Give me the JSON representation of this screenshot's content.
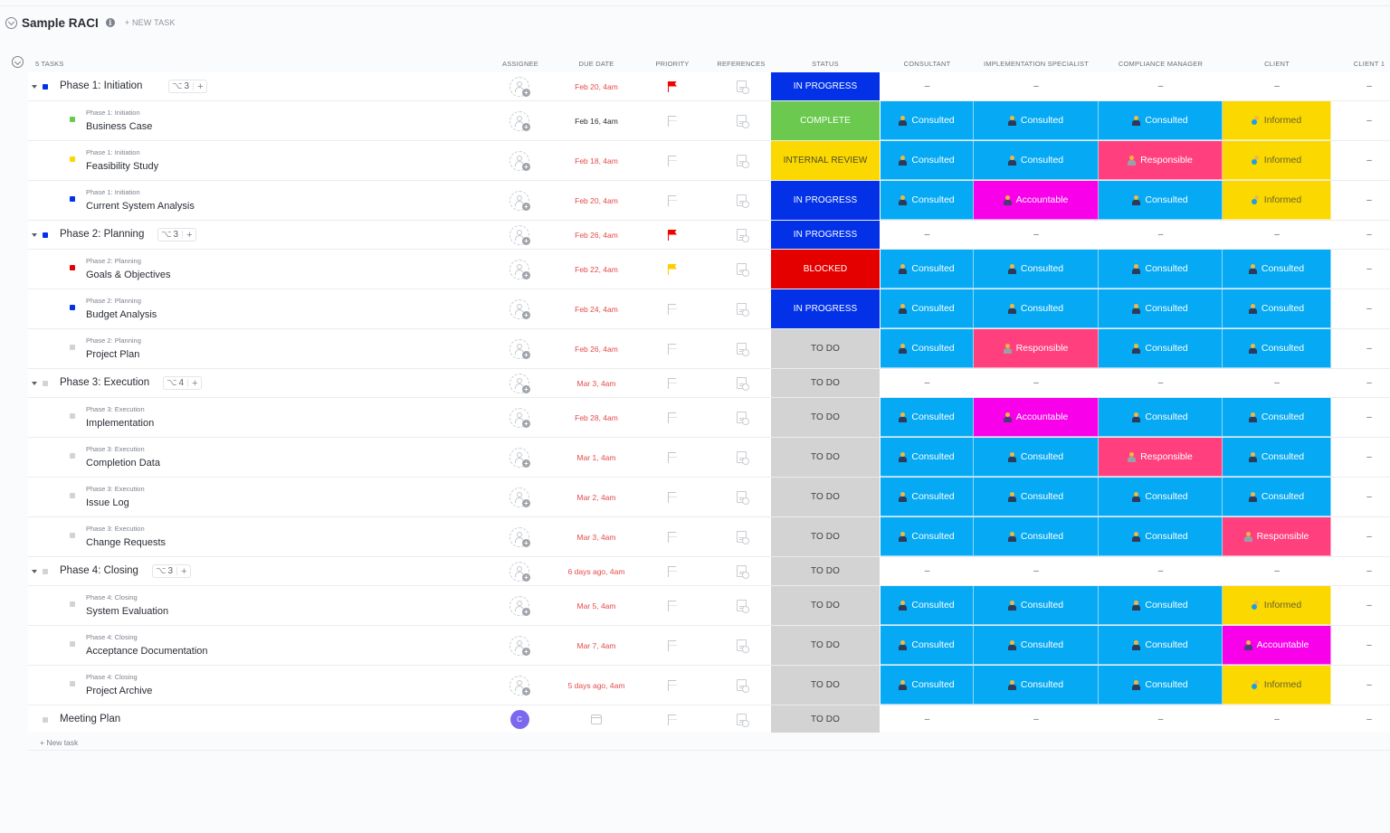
{
  "header": {
    "title": "Sample RACI",
    "new_task_label": "+ NEW TASK",
    "tasks_count": "5 TASKS"
  },
  "columns": {
    "assignee": "ASSIGNEE",
    "due_date": "DUE DATE",
    "priority": "PRIORITY",
    "references": "REFERENCES",
    "status": "STATUS",
    "consultant": "CONSULTANT",
    "implementation_specialist": "IMPLEMENTATION SPECIALIST",
    "compliance_manager": "COMPLIANCE MANAGER",
    "client": "CLIENT",
    "client1": "CLIENT 1"
  },
  "colors": {
    "status": {
      "IN PROGRESS": {
        "bg": "#0231e8",
        "fg": "#ffffff"
      },
      "COMPLETE": {
        "bg": "#6bc950",
        "fg": "#ffffff"
      },
      "INTERNAL REVIEW": {
        "bg": "#fad800",
        "fg": "#4d4a2b"
      },
      "BLOCKED": {
        "bg": "#e50000",
        "fg": "#ffffff"
      },
      "TO DO": {
        "bg": "#d3d3d3",
        "fg": "#3e4147"
      }
    },
    "raci": {
      "Consulted": {
        "bg": "#05a9f4",
        "fg": "#ffffff"
      },
      "Informed": {
        "bg": "#fad800",
        "fg": "#6b6330"
      },
      "Responsible": {
        "bg": "#ff3f7e",
        "fg": "#ffffff"
      },
      "Accountable": {
        "bg": "#f900ea",
        "fg": "#ffffff"
      }
    },
    "priority": {
      "urgent": "#f50000",
      "high": "#ffcc00"
    }
  },
  "rows": [
    {
      "type": "group",
      "name": "Phase 1: Initiation",
      "subtasks": "3",
      "square": "#0231e8",
      "due": "Feb 20, 4am",
      "due_overdue": true,
      "priority": "urgent",
      "status": "IN PROGRESS",
      "raci": [
        "–",
        "–",
        "–",
        "–"
      ],
      "client1": "–"
    },
    {
      "type": "task",
      "crumb": "Phase 1: Initiation",
      "name": "Business Case",
      "square": "#6bc950",
      "due": "Feb 16, 4am",
      "due_overdue": false,
      "priority": "none",
      "status": "COMPLETE",
      "raci": [
        "Consulted",
        "Consulted",
        "Consulted",
        "Informed"
      ],
      "client1": "–"
    },
    {
      "type": "task",
      "crumb": "Phase 1: Initiation",
      "name": "Feasibility Study",
      "square": "#fad800",
      "due": "Feb 18, 4am",
      "due_overdue": true,
      "priority": "none",
      "status": "INTERNAL REVIEW",
      "raci": [
        "Consulted",
        "Consulted",
        "Responsible",
        "Informed"
      ],
      "client1": "–"
    },
    {
      "type": "task",
      "crumb": "Phase 1: Initiation",
      "name": "Current System Analysis",
      "square": "#0231e8",
      "due": "Feb 20, 4am",
      "due_overdue": true,
      "priority": "none",
      "status": "IN PROGRESS",
      "raci": [
        "Consulted",
        "Accountable",
        "Consulted",
        "Informed"
      ],
      "client1": "–"
    },
    {
      "type": "group",
      "name": "Phase 2: Planning",
      "subtasks": "3",
      "square": "#0231e8",
      "due": "Feb 26, 4am",
      "due_overdue": true,
      "priority": "urgent",
      "status": "IN PROGRESS",
      "raci": [
        "–",
        "–",
        "–",
        "–"
      ],
      "client1": "–"
    },
    {
      "type": "task",
      "crumb": "Phase 2: Planning",
      "name": "Goals & Objectives",
      "square": "#e50000",
      "due": "Feb 22, 4am",
      "due_overdue": true,
      "priority": "high",
      "status": "BLOCKED",
      "raci": [
        "Consulted",
        "Consulted",
        "Consulted",
        "Consulted"
      ],
      "client1": "–"
    },
    {
      "type": "task",
      "crumb": "Phase 2: Planning",
      "name": "Budget Analysis",
      "square": "#0231e8",
      "due": "Feb 24, 4am",
      "due_overdue": true,
      "priority": "none",
      "status": "IN PROGRESS",
      "raci": [
        "Consulted",
        "Consulted",
        "Consulted",
        "Consulted"
      ],
      "client1": "–"
    },
    {
      "type": "task",
      "crumb": "Phase 2: Planning",
      "name": "Project Plan",
      "square": "#d3d3d3",
      "due": "Feb 26, 4am",
      "due_overdue": true,
      "priority": "none",
      "status": "TO DO",
      "raci": [
        "Consulted",
        "Responsible",
        "Consulted",
        "Consulted"
      ],
      "client1": "–"
    },
    {
      "type": "group",
      "name": "Phase 3: Execution",
      "subtasks": "4",
      "square": "#d3d3d3",
      "due": "Mar 3, 4am",
      "due_overdue": true,
      "priority": "none",
      "status": "TO DO",
      "raci": [
        "–",
        "–",
        "–",
        "–"
      ],
      "client1": "–"
    },
    {
      "type": "task",
      "crumb": "Phase 3: Execution",
      "name": "Implementation",
      "square": "#d3d3d3",
      "due": "Feb 28, 4am",
      "due_overdue": true,
      "priority": "none",
      "status": "TO DO",
      "raci": [
        "Consulted",
        "Accountable",
        "Consulted",
        "Consulted"
      ],
      "client1": "–"
    },
    {
      "type": "task",
      "crumb": "Phase 3: Execution",
      "name": "Completion Data",
      "square": "#d3d3d3",
      "due": "Mar 1, 4am",
      "due_overdue": true,
      "priority": "none",
      "status": "TO DO",
      "raci": [
        "Consulted",
        "Consulted",
        "Responsible",
        "Consulted"
      ],
      "client1": "–"
    },
    {
      "type": "task",
      "crumb": "Phase 3: Execution",
      "name": "Issue Log",
      "square": "#d3d3d3",
      "due": "Mar 2, 4am",
      "due_overdue": true,
      "priority": "none",
      "status": "TO DO",
      "raci": [
        "Consulted",
        "Consulted",
        "Consulted",
        "Consulted"
      ],
      "client1": "–"
    },
    {
      "type": "task",
      "crumb": "Phase 3: Execution",
      "name": "Change Requests",
      "square": "#d3d3d3",
      "due": "Mar 3, 4am",
      "due_overdue": true,
      "priority": "none",
      "status": "TO DO",
      "raci": [
        "Consulted",
        "Consulted",
        "Consulted",
        "Responsible"
      ],
      "client1": "–"
    },
    {
      "type": "group",
      "name": "Phase 4: Closing",
      "subtasks": "3",
      "square": "#d3d3d3",
      "due": "6 days ago, 4am",
      "due_overdue": true,
      "priority": "none",
      "status": "TO DO",
      "raci": [
        "–",
        "–",
        "–",
        "–"
      ],
      "client1": "–"
    },
    {
      "type": "task",
      "crumb": "Phase 4: Closing",
      "name": "System Evaluation",
      "square": "#d3d3d3",
      "due": "Mar 5, 4am",
      "due_overdue": true,
      "priority": "none",
      "status": "TO DO",
      "raci": [
        "Consulted",
        "Consulted",
        "Consulted",
        "Informed"
      ],
      "client1": "–"
    },
    {
      "type": "task",
      "crumb": "Phase 4: Closing",
      "name": "Acceptance Documentation",
      "square": "#d3d3d3",
      "due": "Mar 7, 4am",
      "due_overdue": true,
      "priority": "none",
      "status": "TO DO",
      "raci": [
        "Consulted",
        "Consulted",
        "Consulted",
        "Accountable"
      ],
      "client1": "–"
    },
    {
      "type": "task",
      "crumb": "Phase 4: Closing",
      "name": "Project Archive",
      "square": "#d3d3d3",
      "due": "5 days ago, 4am",
      "due_overdue": true,
      "priority": "none",
      "status": "TO DO",
      "raci": [
        "Consulted",
        "Consulted",
        "Consulted",
        "Informed"
      ],
      "client1": "–"
    },
    {
      "type": "single",
      "name": "Meeting Plan",
      "square": "#d3d3d3",
      "assignee_initial": "C",
      "due": "",
      "priority": "none",
      "status": "TO DO",
      "raci": [
        "–",
        "–",
        "–",
        "–"
      ],
      "client1": "–"
    }
  ],
  "footer": {
    "new_task_label": "+ New task"
  }
}
